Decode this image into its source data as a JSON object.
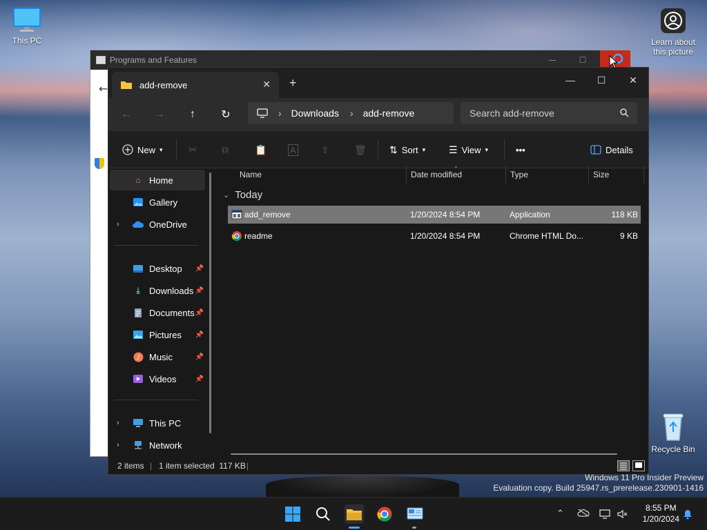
{
  "desktop": {
    "icons": [
      {
        "label": "This PC"
      },
      {
        "label": "Learn about this picture"
      },
      {
        "label": "Recycle Bin"
      }
    ],
    "watermark": {
      "line1": "Windows 11 Pro Insider Preview",
      "line2": "Evaluation copy. Build 25947.rs_prerelease.230901-1416"
    }
  },
  "background_window": {
    "title": "Programs and Features"
  },
  "explorer": {
    "tab_title": "add-remove",
    "breadcrumb": [
      "Downloads",
      "add-remove"
    ],
    "search_placeholder": "Search add-remove",
    "toolbar": {
      "new_label": "New",
      "sort_label": "Sort",
      "view_label": "View",
      "more_label": "•••",
      "details_label": "Details"
    },
    "nav": {
      "items": [
        {
          "label": "Home"
        },
        {
          "label": "Gallery"
        },
        {
          "label": "OneDrive"
        },
        {
          "label": "Desktop"
        },
        {
          "label": "Downloads"
        },
        {
          "label": "Documents"
        },
        {
          "label": "Pictures"
        },
        {
          "label": "Music"
        },
        {
          "label": "Videos"
        },
        {
          "label": "This PC"
        },
        {
          "label": "Network"
        }
      ]
    },
    "columns": [
      "Name",
      "Date modified",
      "Type",
      "Size"
    ],
    "group_label": "Today",
    "files": [
      {
        "name": "add_remove",
        "date": "1/20/2024 8:54 PM",
        "type": "Application",
        "size": "118 KB",
        "icon": "application-icon"
      },
      {
        "name": "readme",
        "date": "1/20/2024 8:54 PM",
        "type": "Chrome HTML Do...",
        "size": "9 KB",
        "icon": "chrome-html-icon"
      }
    ],
    "status": {
      "item_count": "2 items",
      "selection": "1 item selected  117 KB"
    }
  },
  "taskbar": {
    "time": "8:55 PM",
    "date": "1/20/2024"
  },
  "colors": {
    "accent_close": "#c42b1c",
    "explorer_bg": "#191919",
    "selection": "#777777"
  }
}
